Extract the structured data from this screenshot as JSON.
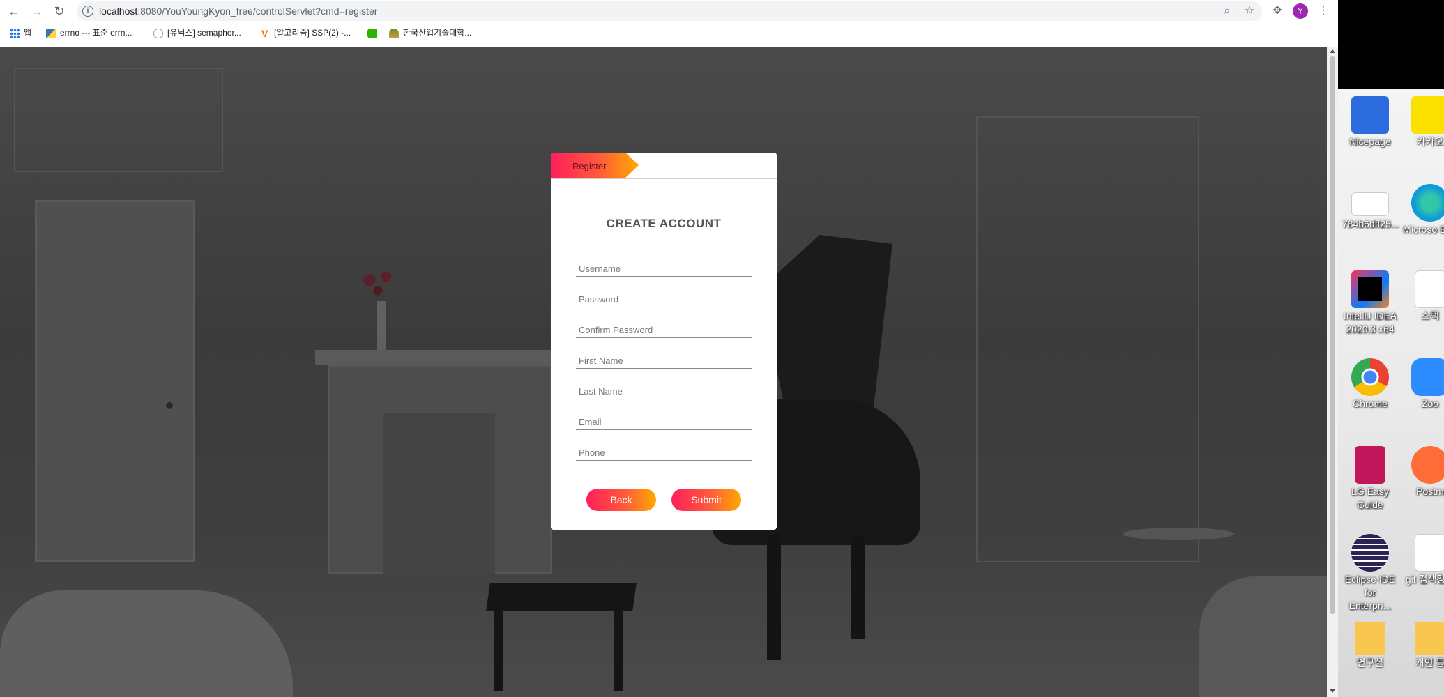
{
  "browser": {
    "url_host": "localhost",
    "url_rest": ":8080/YouYoungKyon_free/controlServlet?cmd=register",
    "avatar_letter": "Y",
    "bookmarks": [
      {
        "label": "앱",
        "icon": "apps-grid-icon",
        "color": "#1a73e8"
      },
      {
        "label": "errno --- 표준 errn...",
        "icon": "python-icon",
        "color": "#3776ab"
      },
      {
        "label": "[유닉스] semaphor...",
        "icon": "swirl-icon",
        "color": "#9e9e9e"
      },
      {
        "label": "[알고리즘] SSP(2) -...",
        "icon": "v-logo-icon",
        "color": "#ff6f00"
      },
      {
        "label": "",
        "icon": "chat-bubble-icon",
        "color": "#2db400"
      },
      {
        "label": "한국산업기술대학...",
        "icon": "school-logo-icon",
        "color": "#6d8b2f"
      }
    ]
  },
  "register": {
    "tab_label": "Register",
    "title": "CREATE ACCOUNT",
    "fields": {
      "username": "Username",
      "password": "Password",
      "confirm_password": "Confirm Password",
      "first_name": "First Name",
      "last_name": "Last Name",
      "email": "Email",
      "phone": "Phone"
    },
    "back_label": "Back",
    "submit_label": "Submit",
    "accent_gradient": [
      "#ff1f5a",
      "#ff5a3c",
      "#ffaa00"
    ]
  },
  "desktop": {
    "icons": [
      {
        "name": "nicepage",
        "label": "Nicepage",
        "color": "#2d6cdf"
      },
      {
        "name": "kakaotalk",
        "label": "카카오",
        "color": "#fae100"
      },
      {
        "name": "image-file",
        "label": "784b6dff25...",
        "color": "#ffffff"
      },
      {
        "name": "microsoft-edge",
        "label": "Microso Edg",
        "color": "#0f9bd7"
      },
      {
        "name": "intellij-idea",
        "label": "IntelliJ IDEA 2020.3 x64",
        "color": "#fe315d"
      },
      {
        "name": "stack-file",
        "label": "스택",
        "color": "#ffffff"
      },
      {
        "name": "chrome",
        "label": "Chrome",
        "color": "#4caf50"
      },
      {
        "name": "zoom",
        "label": "Zoo",
        "color": "#2d8cff"
      },
      {
        "name": "lg-easy-guide",
        "label": "LG Easy Guide",
        "color": "#c2185b"
      },
      {
        "name": "postman",
        "label": "Postm",
        "color": "#ff6c37"
      },
      {
        "name": "eclipse-ide",
        "label": "Eclipse IDE for Enterpri...",
        "color": "#2c2255"
      },
      {
        "name": "git-file",
        "label": "git 검색강의",
        "color": "#ffffff"
      },
      {
        "name": "research-folder",
        "label": "연구실",
        "color": "#f9c74f"
      },
      {
        "name": "personal-folder",
        "label": "개인 등",
        "color": "#f9c74f"
      }
    ]
  }
}
